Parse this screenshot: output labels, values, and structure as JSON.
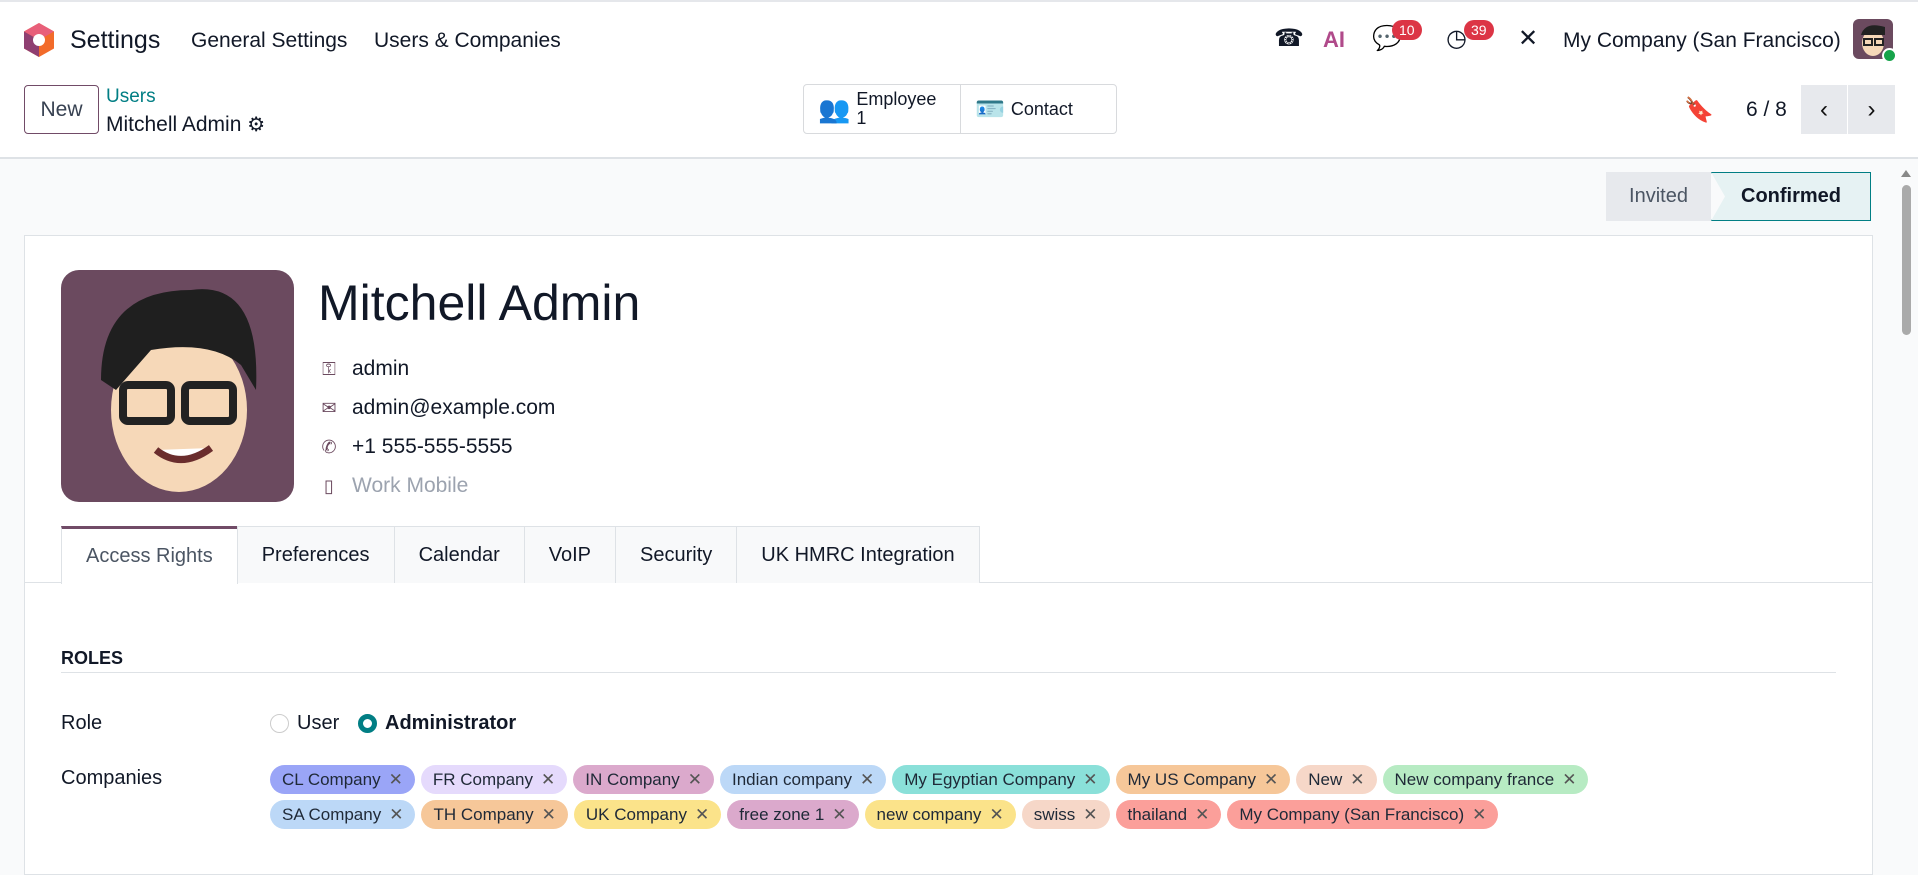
{
  "topbar": {
    "app": "Settings",
    "menus": [
      "General Settings",
      "Users & Companies"
    ],
    "ai": "AI",
    "messages_count": "10",
    "activities_count": "39",
    "company": "My Company (San Francisco)"
  },
  "control": {
    "new": "New",
    "breadcrumb_parent": "Users",
    "breadcrumb_current": "Mitchell Admin",
    "employee_label": "Employee",
    "employee_count": "1",
    "contact_label": "Contact",
    "pager": "6 / 8"
  },
  "status": {
    "stages": [
      "Invited",
      "Confirmed"
    ],
    "current": "Confirmed"
  },
  "user": {
    "name": "Mitchell Admin",
    "login": "admin",
    "email": "admin@example.com",
    "phone": "+1 555-555-5555",
    "mobile_placeholder": "Work Mobile"
  },
  "tabs": [
    "Access Rights",
    "Preferences",
    "Calendar",
    "VoIP",
    "Security",
    "UK HMRC Integration"
  ],
  "access": {
    "section": "ROLES",
    "role_label": "Role",
    "role_options": [
      "User",
      "Administrator"
    ],
    "role_selected": "Administrator",
    "companies_label": "Companies",
    "companies": [
      {
        "name": "CL Company",
        "color": "#9aa5f7"
      },
      {
        "name": "FR Company",
        "color": "#e5dafc"
      },
      {
        "name": "IN Company",
        "color": "#dba9cc"
      },
      {
        "name": "Indian company",
        "color": "#bcd8f7"
      },
      {
        "name": "My Egyptian Company",
        "color": "#8ae0d9"
      },
      {
        "name": "My US Company",
        "color": "#f6c799"
      },
      {
        "name": "New",
        "color": "#f6d7c8"
      },
      {
        "name": "New company france",
        "color": "#b7ebc3"
      },
      {
        "name": "SA Company",
        "color": "#bcd8f7"
      },
      {
        "name": "TH Company",
        "color": "#f6c799"
      },
      {
        "name": "UK Company",
        "color": "#fbe38a"
      },
      {
        "name": "free zone 1",
        "color": "#dba9cc"
      },
      {
        "name": "new company",
        "color": "#fbe38a"
      },
      {
        "name": "swiss",
        "color": "#f6d7c8"
      },
      {
        "name": "thailand",
        "color": "#fb9f9a"
      },
      {
        "name": "My Company (San Francisco)",
        "color": "#fb9f9a"
      }
    ]
  }
}
